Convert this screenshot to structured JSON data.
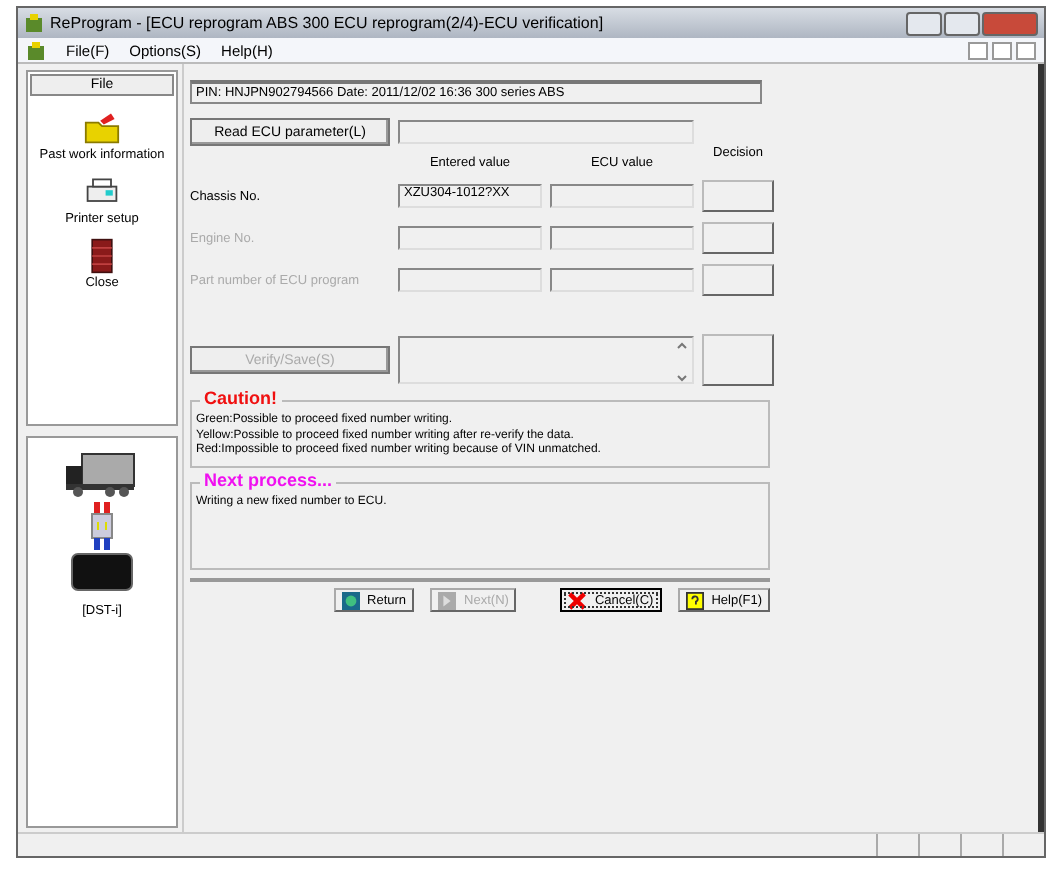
{
  "window": {
    "title": "ReProgram - [ECU reprogram ABS 300 ECU reprogram(2/4)-ECU verification]"
  },
  "menu": [
    "File(F)",
    "Options(S)",
    "Help(H)"
  ],
  "sidebar": {
    "header": "File",
    "items": [
      {
        "label": "Past work information",
        "kind": "folder"
      },
      {
        "label": "Printer setup",
        "kind": "printer"
      },
      {
        "label": "Close",
        "kind": "door"
      }
    ],
    "device_label": "[DST-i]"
  },
  "pin_line": "PIN: HNJPN902794566  Date: 2011/12/02 16:36 300 series ABS",
  "read_button": {
    "label": "Read ECU parameter(L)",
    "disabled": false
  },
  "columns": {
    "entered": "Entered value",
    "ecu": "ECU value",
    "decision": "Decision"
  },
  "rows": [
    {
      "label": "Chassis No.",
      "disabled": false,
      "entered_value": "XZU304-1012?XX"
    },
    {
      "label": "Engine No.",
      "disabled": true
    },
    {
      "label": "Part number of ECU program",
      "disabled": true
    }
  ],
  "verify_button": {
    "label": "Verify/Save(S)",
    "disabled": true
  },
  "caution": {
    "title": "Caution!",
    "lines": [
      "Green:Possible to proceed fixed number writing.",
      "Yellow:Possible to proceed fixed number writing after re-verify the data.",
      "Red:Impossible to proceed fixed number writing because of VIN unmatched."
    ]
  },
  "next_process": {
    "title": "Next process...",
    "text": "Writing a new fixed number to ECU."
  },
  "buttons": [
    {
      "label": "Return",
      "kind": "return",
      "disabled": false,
      "focused": false
    },
    {
      "label": "Next(N)",
      "kind": "next",
      "disabled": true,
      "focused": false
    },
    {
      "label": "Cancel(C)",
      "kind": "cancel",
      "disabled": false,
      "focused": true
    },
    {
      "label": "Help(F1)",
      "kind": "help",
      "disabled": false,
      "focused": false
    }
  ]
}
